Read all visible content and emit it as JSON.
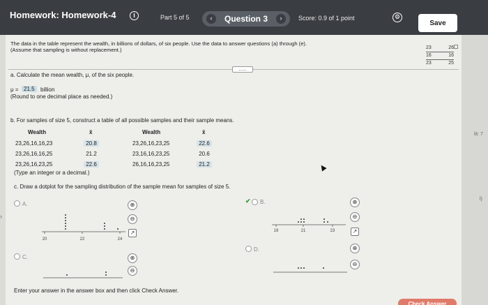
{
  "header": {
    "title": "Homework: Homework-4",
    "part": "Part 5 of 5",
    "question": "Question 3",
    "score": "Score: 0.9 of 1 point",
    "save": "Save"
  },
  "problem": {
    "intro1": "The data in the table represent the wealth, in billions of dollars, of six people. Use the data to answer questions (a) through (e).",
    "intro2": "(Assume that sampling is without replacement.)",
    "data_rows": [
      [
        "23",
        "26"
      ],
      [
        "16",
        "16"
      ],
      [
        "23",
        "25"
      ]
    ]
  },
  "part_a": {
    "prompt": "a. Calculate the mean wealth, μ, of the six people.",
    "mu_prefix": "μ =",
    "mu_value": "21.5",
    "mu_unit": "billion",
    "note": "(Round to one decimal place as needed.)"
  },
  "part_b": {
    "prompt": "b. For samples of size 5, construct a table of all possible samples and their sample means.",
    "col_wealth": "Wealth",
    "col_mean": "x̄",
    "left": [
      {
        "w": "23,26,16,16,23",
        "m": "20.8"
      },
      {
        "w": "23,26,16,16,25",
        "m": "21.2"
      },
      {
        "w": "23,26,16,23,25",
        "m": "22.6"
      }
    ],
    "right": [
      {
        "w": "23,26,16,23,25",
        "m": "22.6"
      },
      {
        "w": "23,16,16,23,25",
        "m": "20.6"
      },
      {
        "w": "26,16,16,23,25",
        "m": "21.2"
      }
    ],
    "note": "(Type an integer or a decimal.)"
  },
  "part_c": {
    "prompt": "c. Draw a dotplot for the sampling distribution of the sample mean for samples of size 5.",
    "options": {
      "a": "A.",
      "b": "B.",
      "c": "C.",
      "d": "D."
    },
    "plot_a_ticks": [
      "20",
      "22",
      "24"
    ],
    "plot_b_ticks": [
      "19",
      "21",
      "23"
    ]
  },
  "footer": {
    "instruction": "Enter your answer in the answer box and then click Check Answer.",
    "check": "Check Answer"
  },
  "side": {
    "t1": "lit: 7",
    "t2": "l)"
  },
  "icons": {
    "info": "info-icon",
    "gear": "gear-icon",
    "zoom": "magnifier-icon",
    "external": "open-new-window-icon"
  }
}
